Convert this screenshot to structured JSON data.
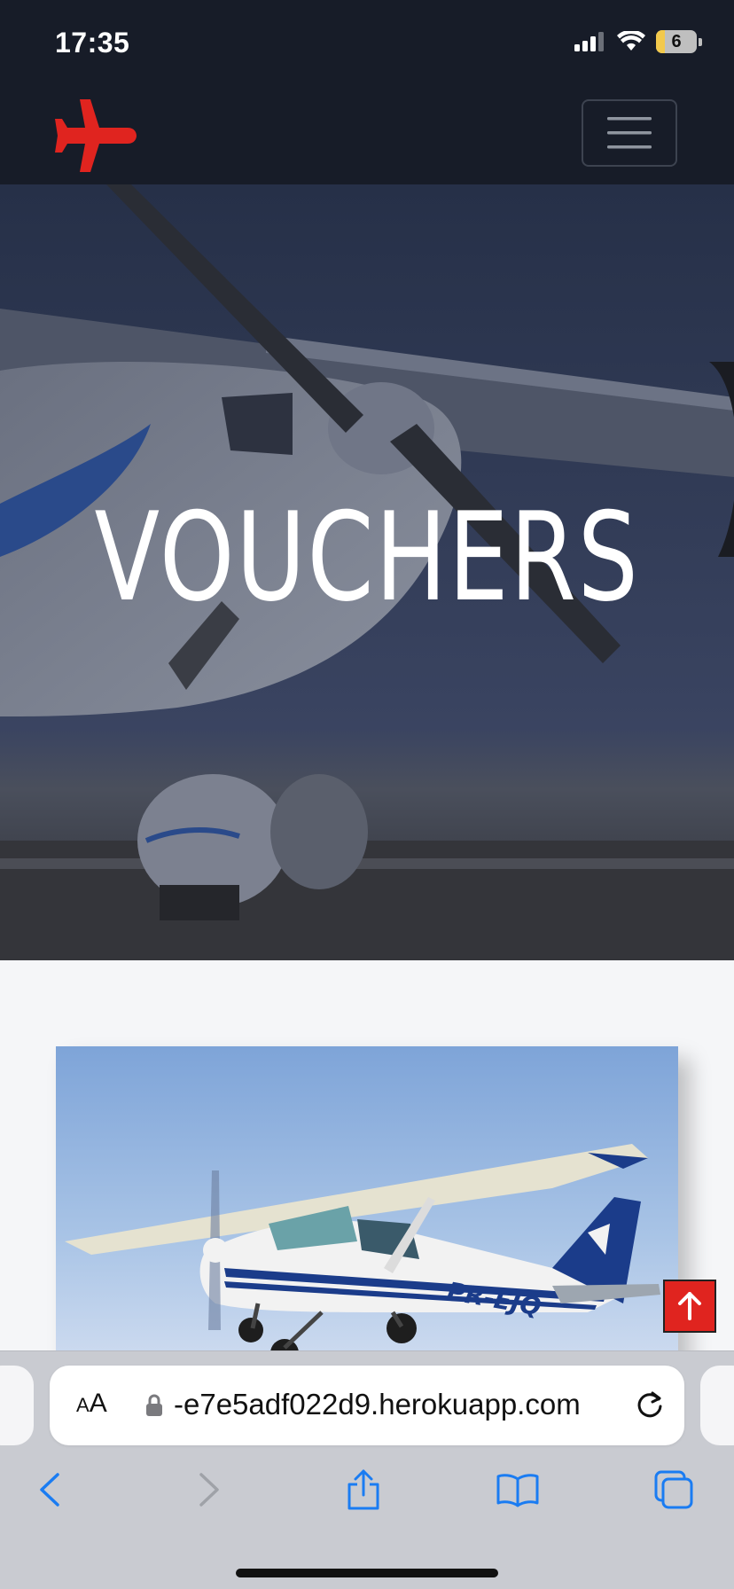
{
  "status_bar": {
    "time": "17:35",
    "battery_level": "6",
    "icons": [
      "signal-icon",
      "wifi-icon",
      "battery-icon"
    ]
  },
  "navbar": {
    "logo": "airplane-logo-icon",
    "menu_toggle": "hamburger-menu-icon",
    "colors": {
      "background": "#171c28",
      "accent": "#e0241f"
    }
  },
  "hero": {
    "title": "VOUCHERS"
  },
  "content": {
    "image": "Cessna airplane in flight",
    "image_label": "PR-EJQ"
  },
  "scroll_top": {
    "icon": "arrow-up-icon"
  },
  "browser": {
    "text_size_label_small": "A",
    "text_size_label_large": "A",
    "url": "-e7e5adf022d9.herokuapp.com",
    "toolbar": [
      "back-icon",
      "forward-icon",
      "share-icon",
      "bookmarks-icon",
      "tabs-icon"
    ],
    "accent": "#1a7cf2"
  }
}
